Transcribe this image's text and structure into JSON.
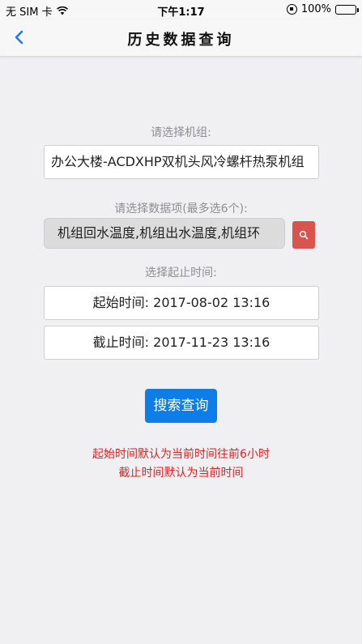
{
  "status_bar": {
    "carrier": "无 SIM 卡",
    "time": "下午1:17",
    "battery": "100%",
    "battery_level": 1.0
  },
  "nav": {
    "title": "历史数据查询",
    "back_icon": "chevron-left-icon"
  },
  "unit": {
    "label": "请选择机组:",
    "value": "办公大楼-ACDXHP双机头风冷螺杆热泵机组"
  },
  "items": {
    "label": "请选择数据项(最多选6个):",
    "value": "机组回水温度,机组出水温度,机组环",
    "search_icon": "search-icon"
  },
  "time": {
    "label": "选择起止时间:",
    "start": "起始时间: 2017-08-02 13:16",
    "end": "截止时间: 2017-11-23 13:16"
  },
  "submit_label": "搜索查询",
  "notes": [
    "起始时间默认为当前时间往前6小时",
    "截止时间默认为当前时间"
  ],
  "colors": {
    "accent": "#0d7ee8",
    "danger": "#d9534f",
    "note": "#e02020"
  }
}
